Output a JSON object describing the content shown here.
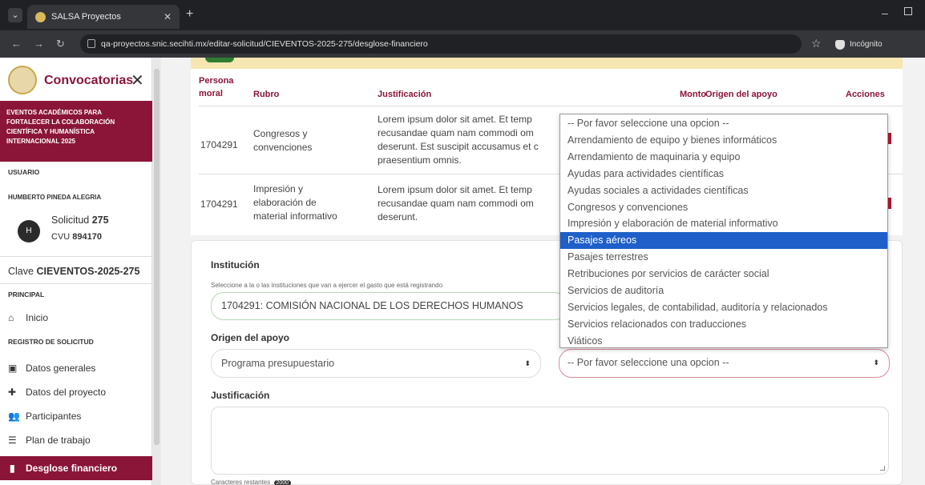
{
  "browser": {
    "tab_title": "SALSA Proyectos",
    "url": "qa-proyectos.snic.secihti.mx/editar-solicitud/CIEVENTOS-2025-275/desglose-financiero",
    "incognito_label": "Incógnito"
  },
  "sidebar": {
    "title": "Convocatorias",
    "event": "EVENTOS ACADÉMICOS PARA FORTALECER LA COLABORACIÓN CIENTÍFICA Y HUMANÍSTICA INTERNACIONAL 2025",
    "user_section": "USUARIO",
    "user_name": "HUMBERTO PINEDA ALEGRIA",
    "avatar_initial": "H",
    "solicitud_label": "Solicitud",
    "solicitud_value": "275",
    "cvu_label": "CVU",
    "cvu_value": "894170",
    "clave_label": "Clave",
    "clave_value": "CIEVENTOS-2025-275",
    "principal_section": "PRINCIPAL",
    "inicio": "Inicio",
    "registro_section": "REGISTRO DE SOLICITUD",
    "items": [
      "Datos generales",
      "Datos del proyecto",
      "Participantes",
      "Plan de trabajo",
      "Desglose financiero"
    ]
  },
  "table": {
    "headers": {
      "persona_1": "Persona",
      "persona_2": "moral",
      "rubro": "Rubro",
      "justificacion": "Justificación",
      "monto": "Monto",
      "origen": "Origen del apoyo",
      "acciones": "Acciones"
    },
    "rows": [
      {
        "persona": "1704291",
        "rubro": [
          "Congresos y",
          "convenciones"
        ],
        "just": [
          "Lorem ipsum dolor sit amet. Et temp",
          "recusandae quam nam commodi om",
          "deserunt. Est suscipit accusamus et c",
          "praesentium omnis."
        ]
      },
      {
        "persona": "1704291",
        "rubro": [
          "Impresión y",
          "elaboración de",
          "material informativo"
        ],
        "just": [
          "Lorem ipsum dolor sit amet. Et temp",
          "recusandae quam nam commodi om",
          "deserunt."
        ]
      }
    ]
  },
  "form": {
    "institucion_label": "Institución",
    "institucion_help": "Seleccione a la o las instituciones que van a ejercer el gasto que está registrando",
    "institucion_value": "1704291: COMISIÓN NACIONAL DE LOS DERECHOS HUMANOS",
    "origen_label": "Origen del apoyo",
    "origen_value": "Programa presupuestario",
    "rubro_value": "-- Por favor seleccione una opcion --",
    "justificacion_label": "Justificación",
    "caracteres_label": "Caracteres restantes",
    "caracteres_value": "2000"
  },
  "dropdown": {
    "selected_index": 7,
    "options": [
      "-- Por favor seleccione una opcion --",
      "Arrendamiento de equipo y bienes informáticos",
      "Arrendamiento de maquinaria y equipo",
      "Ayudas para actividades científicas",
      "Ayudas sociales a actividades científicas",
      "Congresos y convenciones",
      "Impresión y elaboración de material informativo",
      "Pasajes aéreos",
      "Pasajes terrestres",
      "Retribuciones por servicios de carácter social",
      "Servicios de auditoría",
      "Servicios legales, de contabilidad, auditoría y relacionados",
      "Servicios relacionados con traducciones",
      "Viáticos"
    ]
  },
  "colors": {
    "brand": "#8a1538",
    "highlight": "#1e5fc9"
  }
}
